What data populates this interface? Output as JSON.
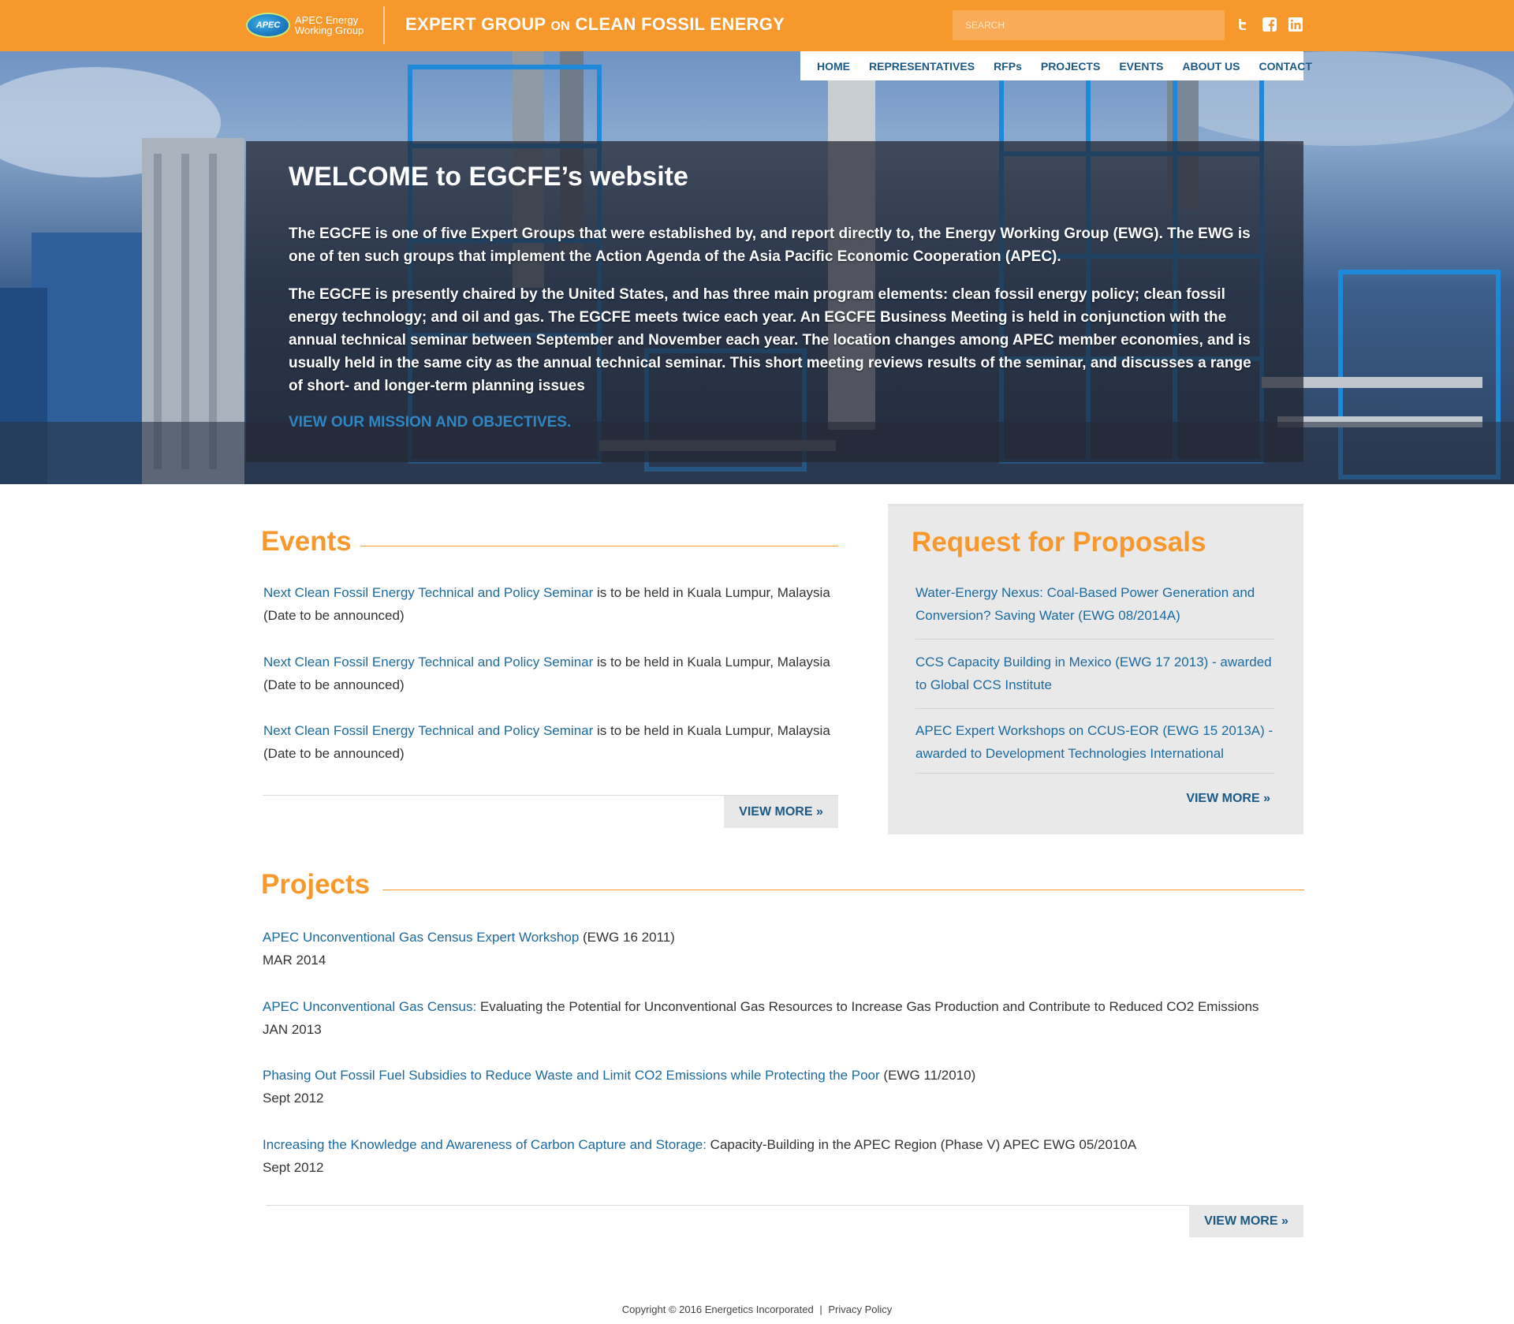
{
  "header": {
    "logo_abbr": "APEC",
    "logo_line1": "APEC Energy",
    "logo_line2": "Working Group",
    "title_part1": "EXPERT GROUP",
    "title_on": "ON",
    "title_part2": "CLEAN FOSSIL ENERGY",
    "search_placeholder": "SEARCH",
    "social": [
      "twitter-icon",
      "facebook-icon",
      "linkedin-icon"
    ],
    "accent_color": "#f7982c"
  },
  "nav": {
    "items": [
      "HOME",
      "REPRESENTATIVES",
      "RFPs",
      "PROJECTS",
      "EVENTS",
      "ABOUT US",
      "CONTACT"
    ]
  },
  "hero": {
    "title": "WELCOME to EGCFE’s website",
    "p1": "The EGCFE is one of five Expert Groups that were established by, and report directly to, the Energy Working Group (EWG). The EWG is one of ten such groups that implement the Action Agenda of the Asia Pacific Economic Cooperation (APEC).",
    "p2": "The EGCFE is presently chaired by the United States, and has three main program elements: clean fossil energy policy; clean fossil energy technology; and oil and gas. The EGCFE meets twice each year. An EGCFE Business Meeting is held in conjunction with the annual technical seminar between September and November each year. The location changes among APEC member economies, and is usually held in the same city as the annual technical seminar. This short meeting reviews results of the seminar, and discusses a range of short- and longer-term planning issues",
    "link": "VIEW OUR MISSION AND OBJECTIVES."
  },
  "events": {
    "title": "Events",
    "items": [
      {
        "link": "Next Clean Fossil Energy Technical and Policy Seminar",
        "text": " is to be held in Kuala Lumpur, Malaysia",
        "date": "(Date to be announced)"
      },
      {
        "link": "Next Clean Fossil Energy Technical and Policy Seminar",
        "text": " is to be held in Kuala Lumpur, Malaysia",
        "date": "(Date to be announced)"
      },
      {
        "link": "Next Clean Fossil Energy Technical and Policy Seminar",
        "text": " is to be held in Kuala Lumpur, Malaysia",
        "date": "(Date to be announced)"
      }
    ],
    "more": "VIEW MORE »"
  },
  "rfp": {
    "title": "Request for Proposals",
    "items": [
      "Water-Energy Nexus: Coal-Based Power Generation and Conversion? Saving Water (EWG 08/2014A)",
      "CCS Capacity Building in Mexico (EWG 17 2013) - awarded to Global CCS Institute",
      "APEC Expert Workshops on CCUS-EOR (EWG 15 2013A) - awarded to Development Technologies International"
    ],
    "more": "VIEW MORE »"
  },
  "projects": {
    "title": "Projects",
    "items": [
      {
        "link": "APEC Unconventional Gas Census Expert Workshop",
        "text": " (EWG 16 2011)",
        "date": "MAR 2014"
      },
      {
        "link": "APEC Unconventional Gas Census:",
        "text": " Evaluating the Potential for Unconventional Gas Resources to Increase Gas Production and Contribute to Reduced CO2 Emissions",
        "date": "JAN 2013"
      },
      {
        "link": "Phasing Out Fossil Fuel Subsidies to Reduce Waste and Limit CO2 Emissions while Protecting the Poor",
        "text": " (EWG 11/2010)",
        "date": "Sept 2012"
      },
      {
        "link": "Increasing the Knowledge and Awareness of Carbon Capture and Storage:",
        "text": " Capacity-Building in the APEC Region (Phase V) APEC EWG 05/2010A",
        "date": "Sept 2012"
      }
    ],
    "more": "VIEW MORE »"
  },
  "footer": {
    "copyright": "Copyright © 2016 Energetics Incorporated",
    "separator": "|",
    "privacy": "Privacy Policy"
  }
}
